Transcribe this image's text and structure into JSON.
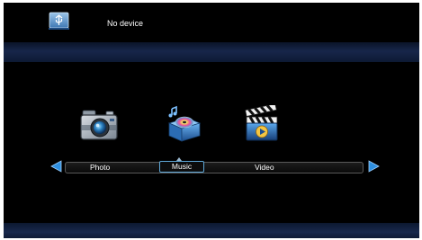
{
  "device": {
    "icon": "usb-device-icon",
    "status": "No device"
  },
  "menu": {
    "items": [
      {
        "label": "Photo",
        "icon": "camera-icon"
      },
      {
        "label": "Music",
        "icon": "music-box-icon"
      },
      {
        "label": "Video",
        "icon": "clapperboard-icon"
      }
    ],
    "selected": "Music"
  },
  "colors": {
    "background": "#000000",
    "band": "#17264a",
    "accent": "#2e8fe0",
    "selection_border": "#5fa8d8"
  }
}
